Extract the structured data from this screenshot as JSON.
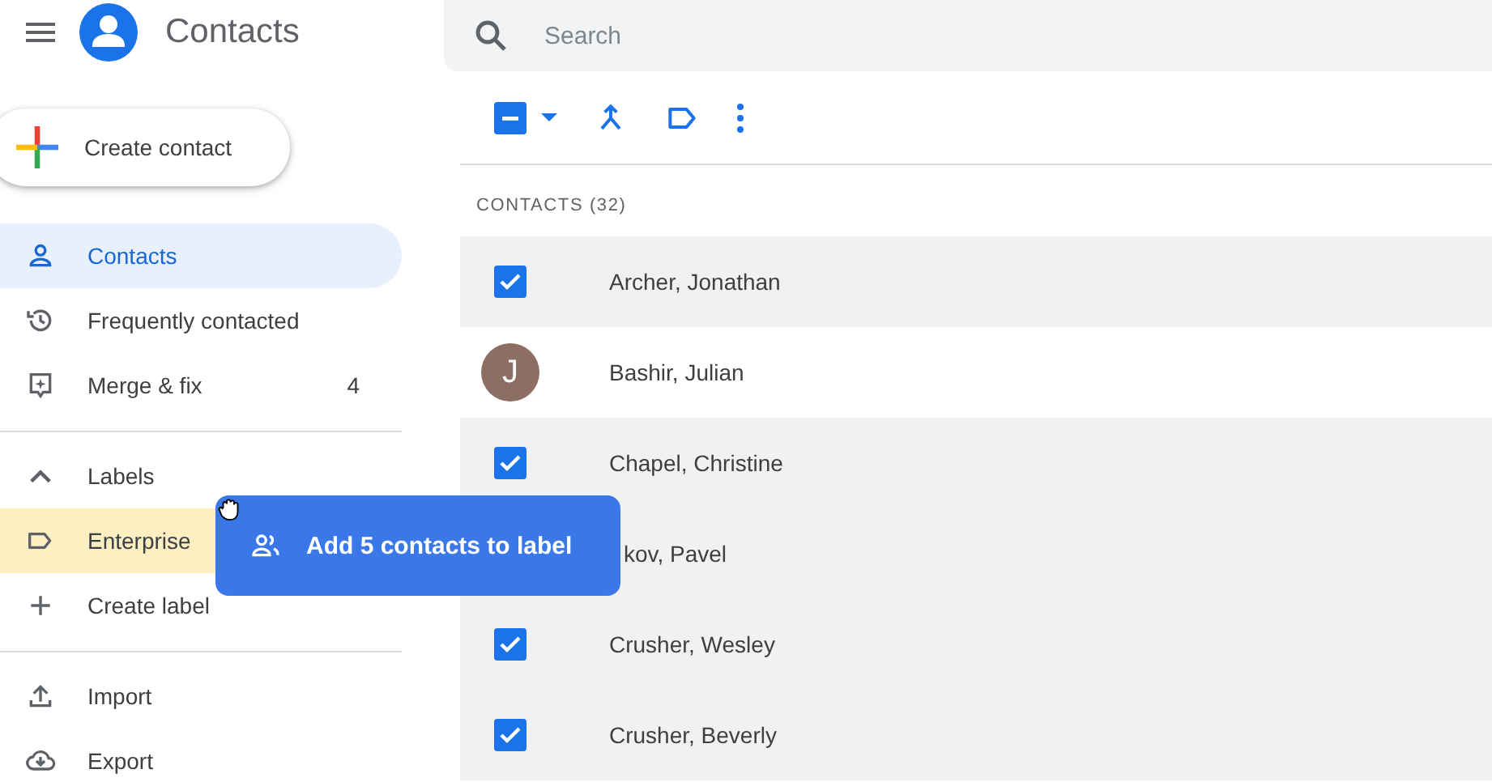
{
  "app": {
    "title": "Contacts"
  },
  "search": {
    "placeholder": "Search"
  },
  "create_button": {
    "label": "Create contact"
  },
  "nav": [
    {
      "kind": "person",
      "label": "Contacts",
      "selected": true
    },
    {
      "kind": "history",
      "label": "Frequently contacted",
      "selected": false
    },
    {
      "kind": "merge",
      "label": "Merge & fix",
      "selected": false,
      "count": "4"
    }
  ],
  "labels_header": {
    "label": "Labels",
    "expanded": true
  },
  "labels": [
    {
      "kind": "label",
      "label": "Enterprise",
      "drop_target": true
    },
    {
      "kind": "create",
      "label": "Create label",
      "drop_target": false
    }
  ],
  "actions": [
    {
      "kind": "import",
      "label": "Import"
    },
    {
      "kind": "export",
      "label": "Export"
    }
  ],
  "toolbar": {
    "select_all_checked": true,
    "select_all_indeterminate": true
  },
  "list_heading": "CONTACTS (32)",
  "contacts": [
    {
      "kind": "checkbox",
      "name": "Archer, Jonathan",
      "selected": true
    },
    {
      "kind": "avatar",
      "name": "Bashir, Julian",
      "initial": "J",
      "selected": false
    },
    {
      "kind": "checkbox",
      "name": "Chapel, Christine",
      "selected": true
    },
    {
      "kind": "covered",
      "name": "kov, Pavel",
      "selected": true
    },
    {
      "kind": "checkbox",
      "name": "Crusher, Wesley",
      "selected": true
    },
    {
      "kind": "checkbox",
      "name": "Crusher, Beverly",
      "selected": true
    }
  ],
  "drag_chip": {
    "label": "Add 5 contacts to label"
  }
}
